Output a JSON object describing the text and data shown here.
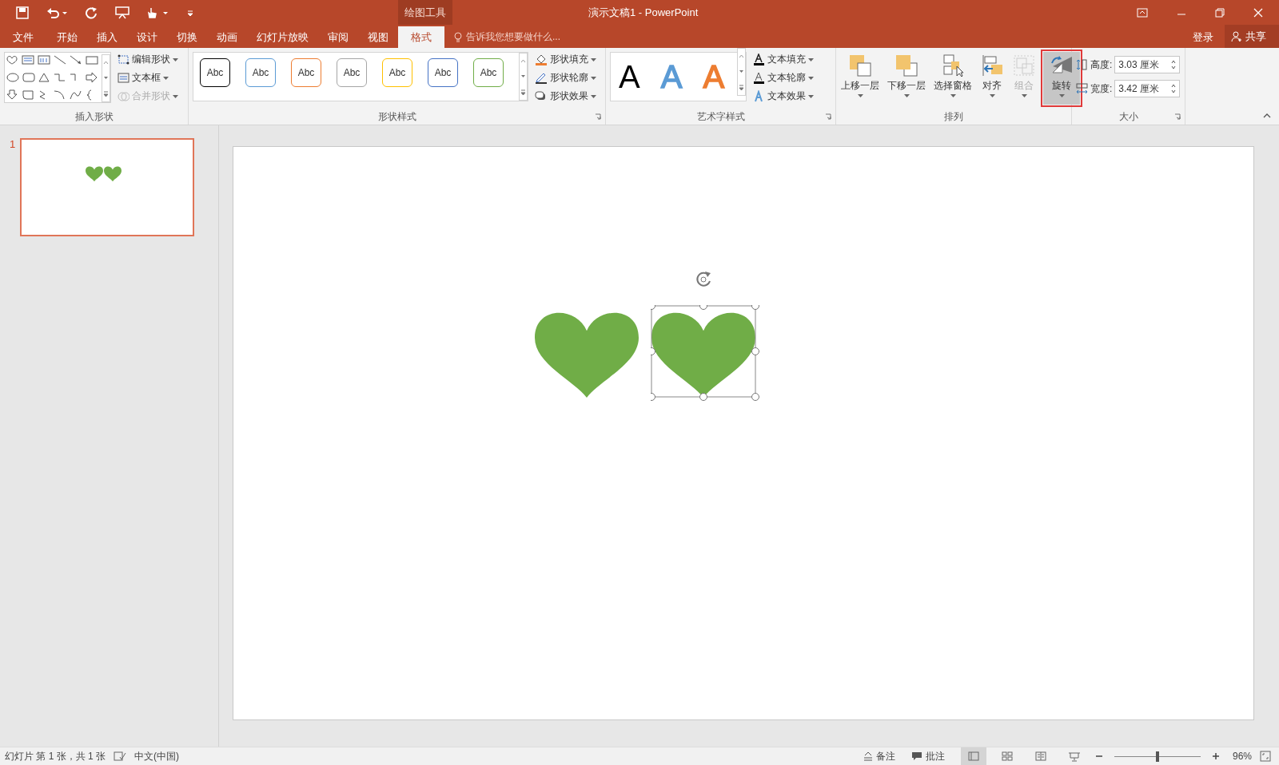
{
  "title_bar": {
    "contextual_tab": "绘图工具",
    "title": "演示文稿1 - PowerPoint"
  },
  "tabs": [
    {
      "label": "文件",
      "selected": false
    },
    {
      "label": "开始",
      "selected": false
    },
    {
      "label": "插入",
      "selected": false
    },
    {
      "label": "设计",
      "selected": false
    },
    {
      "label": "切换",
      "selected": false
    },
    {
      "label": "动画",
      "selected": false
    },
    {
      "label": "幻灯片放映",
      "selected": false
    },
    {
      "label": "审阅",
      "selected": false
    },
    {
      "label": "视图",
      "selected": false
    },
    {
      "label": "格式",
      "selected": true
    }
  ],
  "tell_me": {
    "placeholder": "告诉我您想要做什么..."
  },
  "account": {
    "sign_in": "登录",
    "share": "共享"
  },
  "ribbon": {
    "insert_shapes": {
      "label": "插入形状",
      "commands": [
        {
          "label": "编辑形状",
          "disabled": false
        },
        {
          "label": "文本框",
          "disabled": false
        },
        {
          "label": "合并形状",
          "disabled": true
        }
      ]
    },
    "shape_styles": {
      "label": "形状样式",
      "presets": [
        {
          "label": "Abc",
          "color": "#000000"
        },
        {
          "label": "Abc",
          "color": "#5b9bd5"
        },
        {
          "label": "Abc",
          "color": "#ed7d31"
        },
        {
          "label": "Abc",
          "color": "#a5a5a5"
        },
        {
          "label": "Abc",
          "color": "#ffc000"
        },
        {
          "label": "Abc",
          "color": "#4472c4"
        },
        {
          "label": "Abc",
          "color": "#70ad47"
        }
      ],
      "commands": [
        {
          "label": "形状填充"
        },
        {
          "label": "形状轮廓"
        },
        {
          "label": "形状效果"
        }
      ]
    },
    "wordart_styles": {
      "label": "艺术字样式",
      "presets": [
        {
          "label": "A",
          "color": "#000000"
        },
        {
          "label": "A",
          "color": "#5b9bd5"
        },
        {
          "label": "A",
          "color": "#ed7d31"
        }
      ],
      "commands": [
        {
          "label": "文本填充"
        },
        {
          "label": "文本轮廓"
        },
        {
          "label": "文本效果"
        }
      ]
    },
    "arrange": {
      "label": "排列",
      "buttons": [
        {
          "label": "上移一层",
          "disabled": false,
          "selected": false
        },
        {
          "label": "下移一层",
          "disabled": false,
          "selected": false
        },
        {
          "label": "选择窗格",
          "disabled": false,
          "selected": false
        },
        {
          "label": "对齐",
          "disabled": false,
          "selected": false
        },
        {
          "label": "组合",
          "disabled": true,
          "selected": false
        },
        {
          "label": "旋转",
          "disabled": false,
          "selected": true
        }
      ]
    },
    "size": {
      "label": "大小",
      "fields": [
        {
          "label": "高度:",
          "value": "3.03 厘米"
        },
        {
          "label": "宽度:",
          "value": "3.42 厘米"
        }
      ]
    }
  },
  "thumbnails": [
    {
      "number": "1",
      "selected": true
    }
  ],
  "slide": {
    "hearts": [
      {
        "selected": false
      },
      {
        "selected": true
      }
    ]
  },
  "status_bar": {
    "slide_info": "幻灯片 第 1 张，共 1 张",
    "language": "中文(中国)",
    "notes": "备注",
    "comments": "批注",
    "views": [
      {
        "selected": true
      },
      {
        "selected": false
      },
      {
        "selected": false
      },
      {
        "selected": false
      }
    ],
    "zoom": {
      "level": 0.5
    },
    "zoom_text": "96%"
  }
}
